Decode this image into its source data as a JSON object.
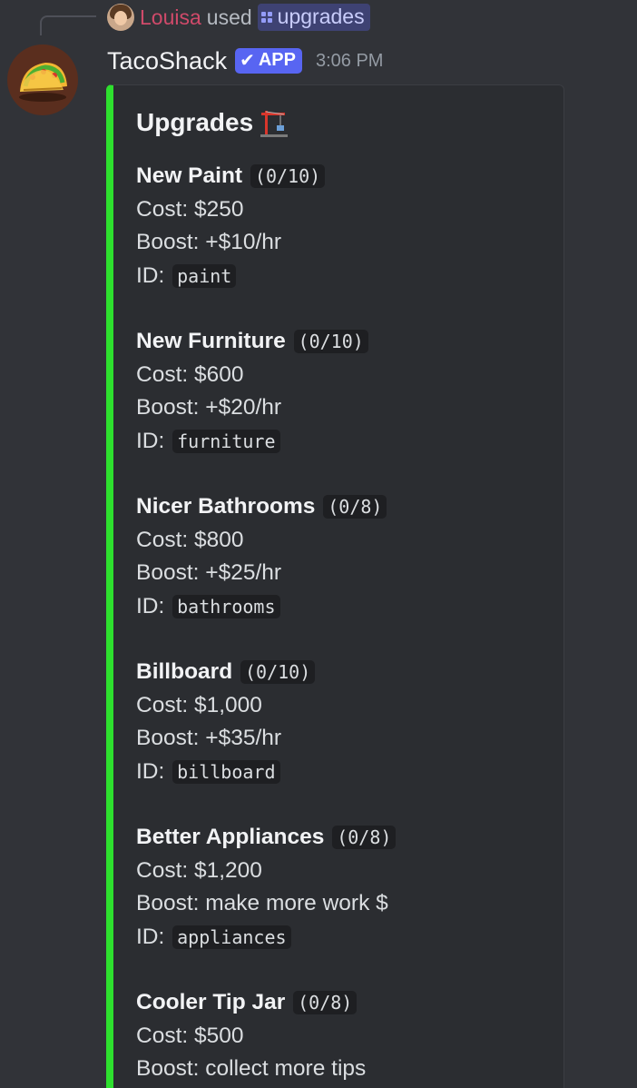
{
  "reply": {
    "user": "Louisa",
    "action": "used",
    "command": "upgrades"
  },
  "message": {
    "author": "TacoShack",
    "badge": "APP",
    "time": "3:06 PM"
  },
  "embed": {
    "title": "Upgrades",
    "title_emoji": "construction-crane-icon",
    "accent_color": "#2ee02e",
    "items": [
      {
        "name": "New Paint",
        "progress": "(0/10)",
        "cost": "Cost: $250",
        "boost": "Boost: +$10/hr",
        "id_label": "ID:",
        "id": "paint"
      },
      {
        "name": "New Furniture",
        "progress": "(0/10)",
        "cost": "Cost: $600",
        "boost": "Boost: +$20/hr",
        "id_label": "ID:",
        "id": "furniture"
      },
      {
        "name": "Nicer Bathrooms",
        "progress": "(0/8)",
        "cost": "Cost: $800",
        "boost": "Boost: +$25/hr",
        "id_label": "ID:",
        "id": "bathrooms"
      },
      {
        "name": "Billboard",
        "progress": "(0/10)",
        "cost": "Cost: $1,000",
        "boost": "Boost: +$35/hr",
        "id_label": "ID:",
        "id": "billboard"
      },
      {
        "name": "Better Appliances",
        "progress": "(0/8)",
        "cost": "Cost: $1,200",
        "boost": "Boost: make more work $",
        "id_label": "ID:",
        "id": "appliances"
      },
      {
        "name": "Cooler Tip Jar",
        "progress": "(0/8)",
        "cost": "Cost: $500",
        "boost": "Boost: collect more tips"
      }
    ]
  }
}
